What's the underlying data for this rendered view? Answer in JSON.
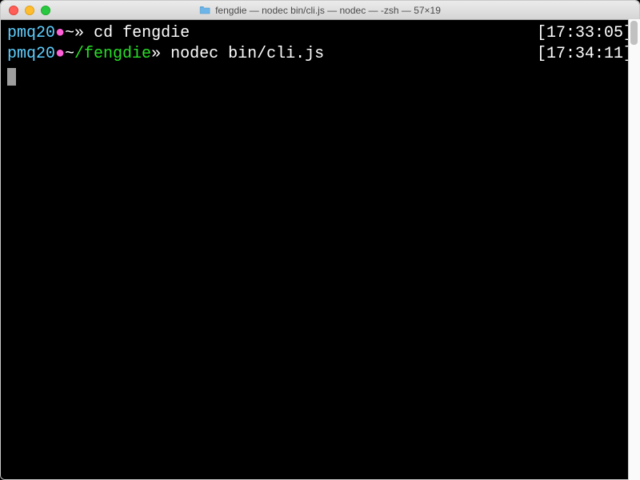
{
  "window": {
    "title": "fengdie — nodec bin/cli.js — nodec — -zsh — 57×19"
  },
  "lines": [
    {
      "user": "pmq20",
      "dot": "●",
      "tilde": "~",
      "path": "",
      "chevron": "» ",
      "command": "cd fengdie",
      "timestamp": "[17:33:05]"
    },
    {
      "user": "pmq20",
      "dot": "●",
      "tilde": "~",
      "path": "/fengdie",
      "chevron": "» ",
      "command": "nodec bin/cli.js",
      "timestamp": "[17:34:11]"
    }
  ]
}
